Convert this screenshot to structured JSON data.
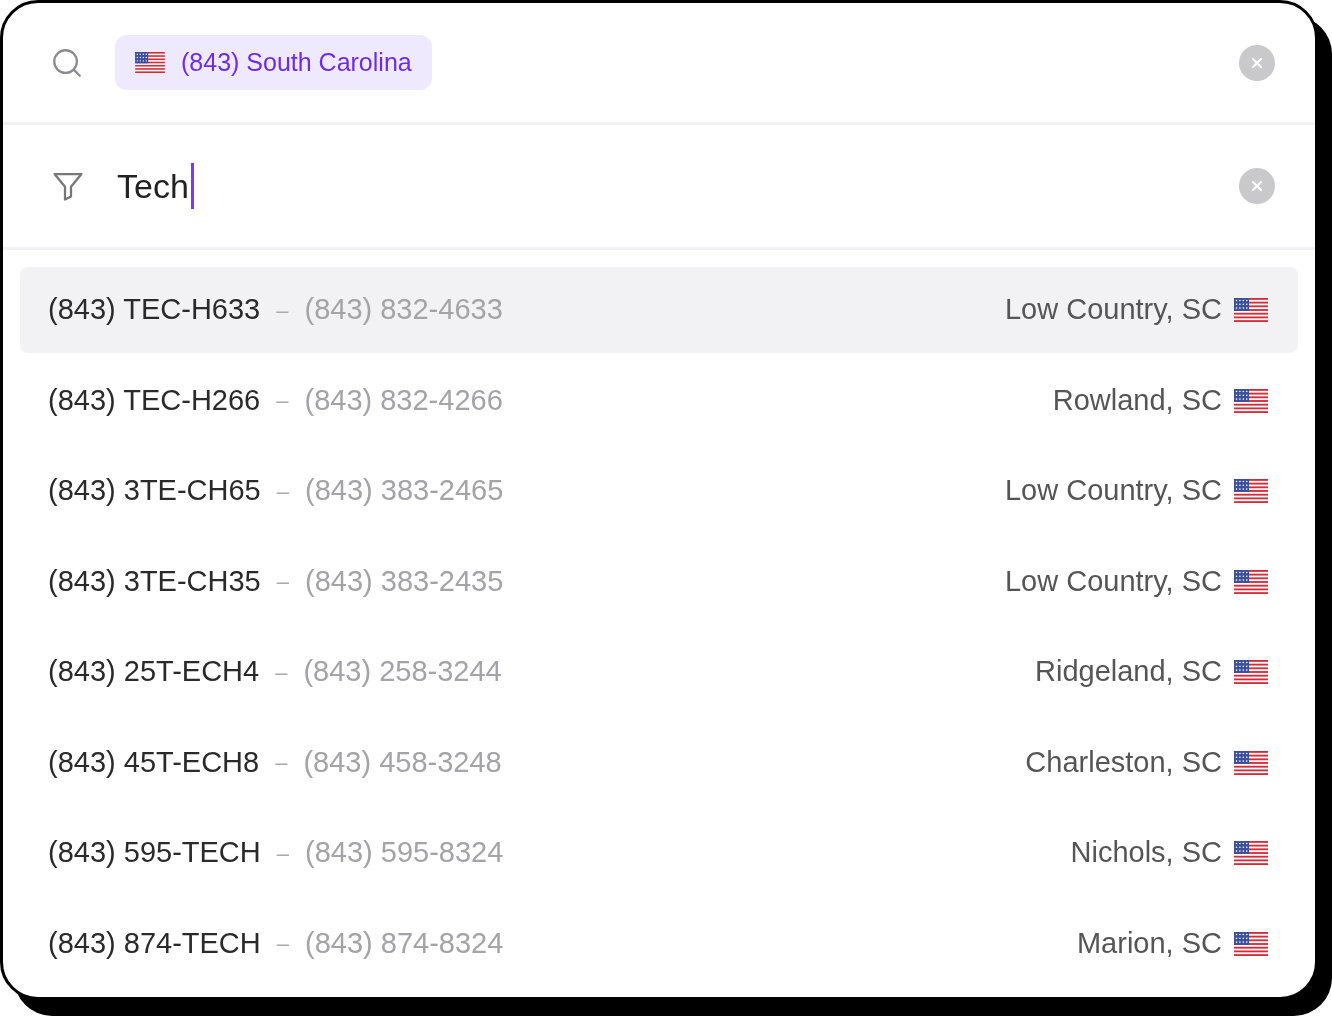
{
  "search": {
    "chip": {
      "label": "(843) South Carolina"
    }
  },
  "filter": {
    "value": "Tech"
  },
  "results": [
    {
      "vanity": "(843) TEC-H633",
      "separator": "–",
      "number": "(843) 832-4633",
      "location": "Low Country, SC",
      "selected": true
    },
    {
      "vanity": "(843) TEC-H266",
      "separator": "–",
      "number": "(843) 832-4266",
      "location": "Rowland, SC",
      "selected": false
    },
    {
      "vanity": "(843) 3TE-CH65",
      "separator": "–",
      "number": "(843) 383-2465",
      "location": "Low Country, SC",
      "selected": false
    },
    {
      "vanity": "(843) 3TE-CH35",
      "separator": "–",
      "number": "(843) 383-2435",
      "location": "Low Country, SC",
      "selected": false
    },
    {
      "vanity": "(843) 25T-ECH4",
      "separator": "–",
      "number": "(843) 258-3244",
      "location": "Ridgeland, SC",
      "selected": false
    },
    {
      "vanity": "(843) 45T-ECH8",
      "separator": "–",
      "number": "(843) 458-3248",
      "location": "Charleston, SC",
      "selected": false
    },
    {
      "vanity": "(843) 595-TECH",
      "separator": "–",
      "number": "(843) 595-8324",
      "location": "Nichols, SC",
      "selected": false
    },
    {
      "vanity": "(843) 874-TECH",
      "separator": "–",
      "number": "(843) 874-8324",
      "location": "Marion, SC",
      "selected": false
    }
  ]
}
